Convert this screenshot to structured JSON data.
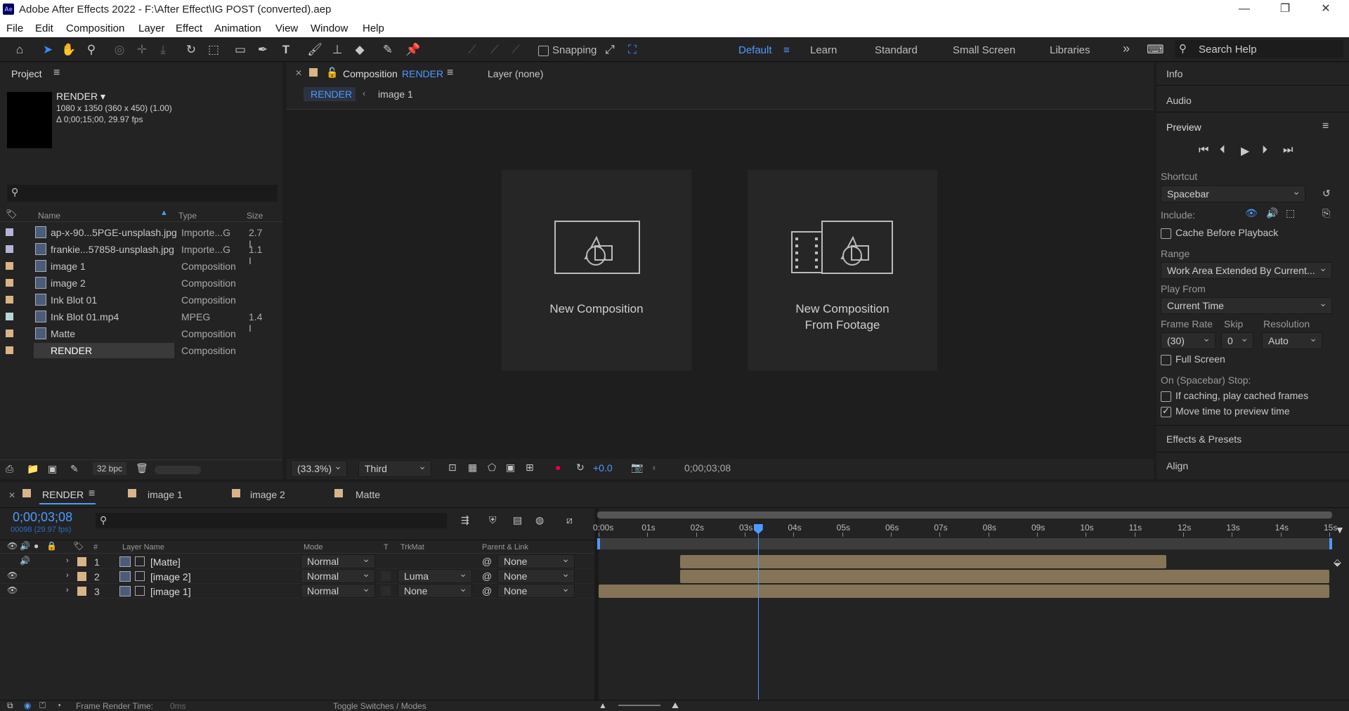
{
  "window": {
    "app_badge": "Ae",
    "title": "Adobe After Effects 2022 - F:\\After Effect\\IG POST (converted).aep",
    "minimize": "—",
    "maximize": "❐",
    "close": "✕"
  },
  "menu": [
    "File",
    "Edit",
    "Composition",
    "Layer",
    "Effect",
    "Animation",
    "View",
    "Window",
    "Help"
  ],
  "toolbar": {
    "snapping": "Snapping",
    "workspaces": [
      "Default",
      "Learn",
      "Standard",
      "Small Screen",
      "Libraries"
    ],
    "more": "»",
    "search_placeholder": "Search Help"
  },
  "project": {
    "panel_title": "Project",
    "comp_name": "RENDER ▾",
    "comp_info1": "1080 x 1350  (360 x 450) (1.00)",
    "comp_info2": "Δ 0;00;15;00, 29.97 fps",
    "columns": [
      "Name",
      "Type",
      "Size"
    ],
    "items": [
      {
        "name": "ap-x-90...5PGE-unsplash.jpg",
        "type": "Importe...G",
        "size": "2.7 I",
        "color": "#b4b4d8",
        "icon": "image-file-icon"
      },
      {
        "name": "frankie...57858-unsplash.jpg",
        "type": "Importe...G",
        "size": "1.1 I",
        "color": "#b4b4d8",
        "icon": "image-file-icon"
      },
      {
        "name": "image 1",
        "type": "Composition",
        "size": "",
        "color": "#d8b488",
        "icon": "composition-icon"
      },
      {
        "name": "image 2",
        "type": "Composition",
        "size": "",
        "color": "#d8b488",
        "icon": "composition-icon"
      },
      {
        "name": "Ink Blot 01",
        "type": "Composition",
        "size": "",
        "color": "#d8b488",
        "icon": "composition-icon"
      },
      {
        "name": "Ink Blot 01.mp4",
        "type": "MPEG",
        "size": "1.4 I",
        "color": "#b4d8d8",
        "icon": "video-file-icon"
      },
      {
        "name": "Matte",
        "type": "Composition",
        "size": "",
        "color": "#d8b488",
        "icon": "composition-icon"
      },
      {
        "name": "RENDER",
        "type": "Composition",
        "size": "",
        "color": "#d8b488",
        "icon": "composition-icon"
      }
    ],
    "bpc": "32 bpc"
  },
  "viewer": {
    "tab_prefix": "Composition",
    "tab_name": "RENDER",
    "layer_tab": "Layer  (none)",
    "crumb1": "RENDER",
    "crumb2": "image 1",
    "card1": "New Composition",
    "card2_l1": "New Composition",
    "card2_l2": "From Footage",
    "zoom": "(33.3%)",
    "resolution": "Third",
    "exposure": "+0.0",
    "timecode": "0;00;03;08"
  },
  "right": {
    "info": "Info",
    "audio": "Audio",
    "preview": "Preview",
    "shortcut_label": "Shortcut",
    "shortcut": "Spacebar",
    "include": "Include:",
    "cache": "Cache Before Playback",
    "range_label": "Range",
    "range": "Work Area Extended By Current...",
    "playfrom_label": "Play From",
    "playfrom": "Current Time",
    "framerate_label": "Frame Rate",
    "skip_label": "Skip",
    "res_label": "Resolution",
    "framerate": "(30)",
    "skip": "0",
    "res": "Auto",
    "fullscreen": "Full Screen",
    "stop_label": "On (Spacebar) Stop:",
    "if_caching": "If caching, play cached frames",
    "move_time": "Move time to preview time",
    "effects": "Effects & Presets",
    "align": "Align"
  },
  "timeline": {
    "tabs": [
      "RENDER",
      "image 1",
      "image 2",
      "Matte"
    ],
    "timecode": "0;00;03;08",
    "frames": "00098 (29.97 fps)",
    "cols": {
      "hash": "#",
      "name": "Layer Name",
      "mode": "Mode",
      "t": "T",
      "trkmat": "TrkMat",
      "parent": "Parent & Link"
    },
    "ruler": [
      "0:00s",
      "01s",
      "02s",
      "03s",
      "04s",
      "05s",
      "06s",
      "07s",
      "08s",
      "09s",
      "10s",
      "11s",
      "12s",
      "13s",
      "14s",
      "15s"
    ],
    "layers": [
      {
        "num": "1",
        "name": "[Matte]",
        "mode": "Normal",
        "trkmat": "",
        "parent": "None",
        "in": 1.67,
        "out": 11.65
      },
      {
        "num": "2",
        "name": "[image 2]",
        "mode": "Normal",
        "trkmat": "Luma",
        "parent": "None",
        "in": 1.67,
        "out": 15.1
      },
      {
        "num": "3",
        "name": "[image 1]",
        "mode": "Normal",
        "trkmat": "None",
        "parent": "None",
        "in": 0.0,
        "out": 15.0
      }
    ],
    "current_time_s": 3.27,
    "duration_s": 15,
    "footer_render": "Frame Render Time:",
    "footer_ms": "0ms",
    "footer_toggle": "Toggle Switches / Modes"
  }
}
